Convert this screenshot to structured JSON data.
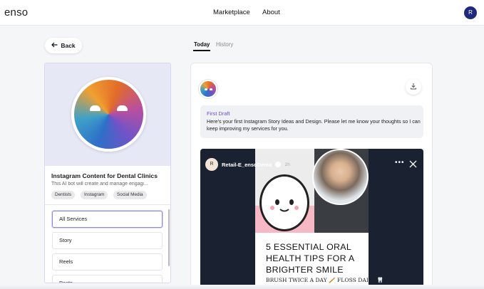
{
  "header": {
    "logo": "enso",
    "nav": [
      "Marketplace",
      "About"
    ],
    "avatar_initial": "R"
  },
  "back_button": {
    "label": "Back"
  },
  "service_card": {
    "title": "Instagram Content for Dental Clinics",
    "description": "This AI bot will create and manage engagi...",
    "tags": [
      "Dentists",
      "Instagram",
      "Social Media"
    ],
    "services": [
      "All Services",
      "Story",
      "Reels",
      "Posts"
    ],
    "active_service": "All Services"
  },
  "tabs": {
    "items": [
      "Today",
      "History"
    ],
    "active": "Today"
  },
  "draft": {
    "heading": "First Draft",
    "text": "Here's your first Instagram Story Ideas and Design. Please let me know your thoughts so I can keep improving my services for you."
  },
  "story": {
    "avatar_initial": "R",
    "username": "Retail-E_ensoDemo",
    "time": "2h",
    "headline": "5 ESSENTIAL ORAL HEALTH TIPS FOR A BRIGHTER SMILE",
    "subline": "BRUSH TWICE A DAY 🪥 FLOSS DAILY 🦷"
  },
  "colors": {
    "accent": "#5a56d0",
    "avatar_bg": "#1f2b7a",
    "story_bg": "#1a2232",
    "pink_band": "#f6b8c4"
  },
  "icons": [
    "arrow-left-icon",
    "download-icon",
    "more-dots-icon",
    "close-icon",
    "verified-icon"
  ]
}
